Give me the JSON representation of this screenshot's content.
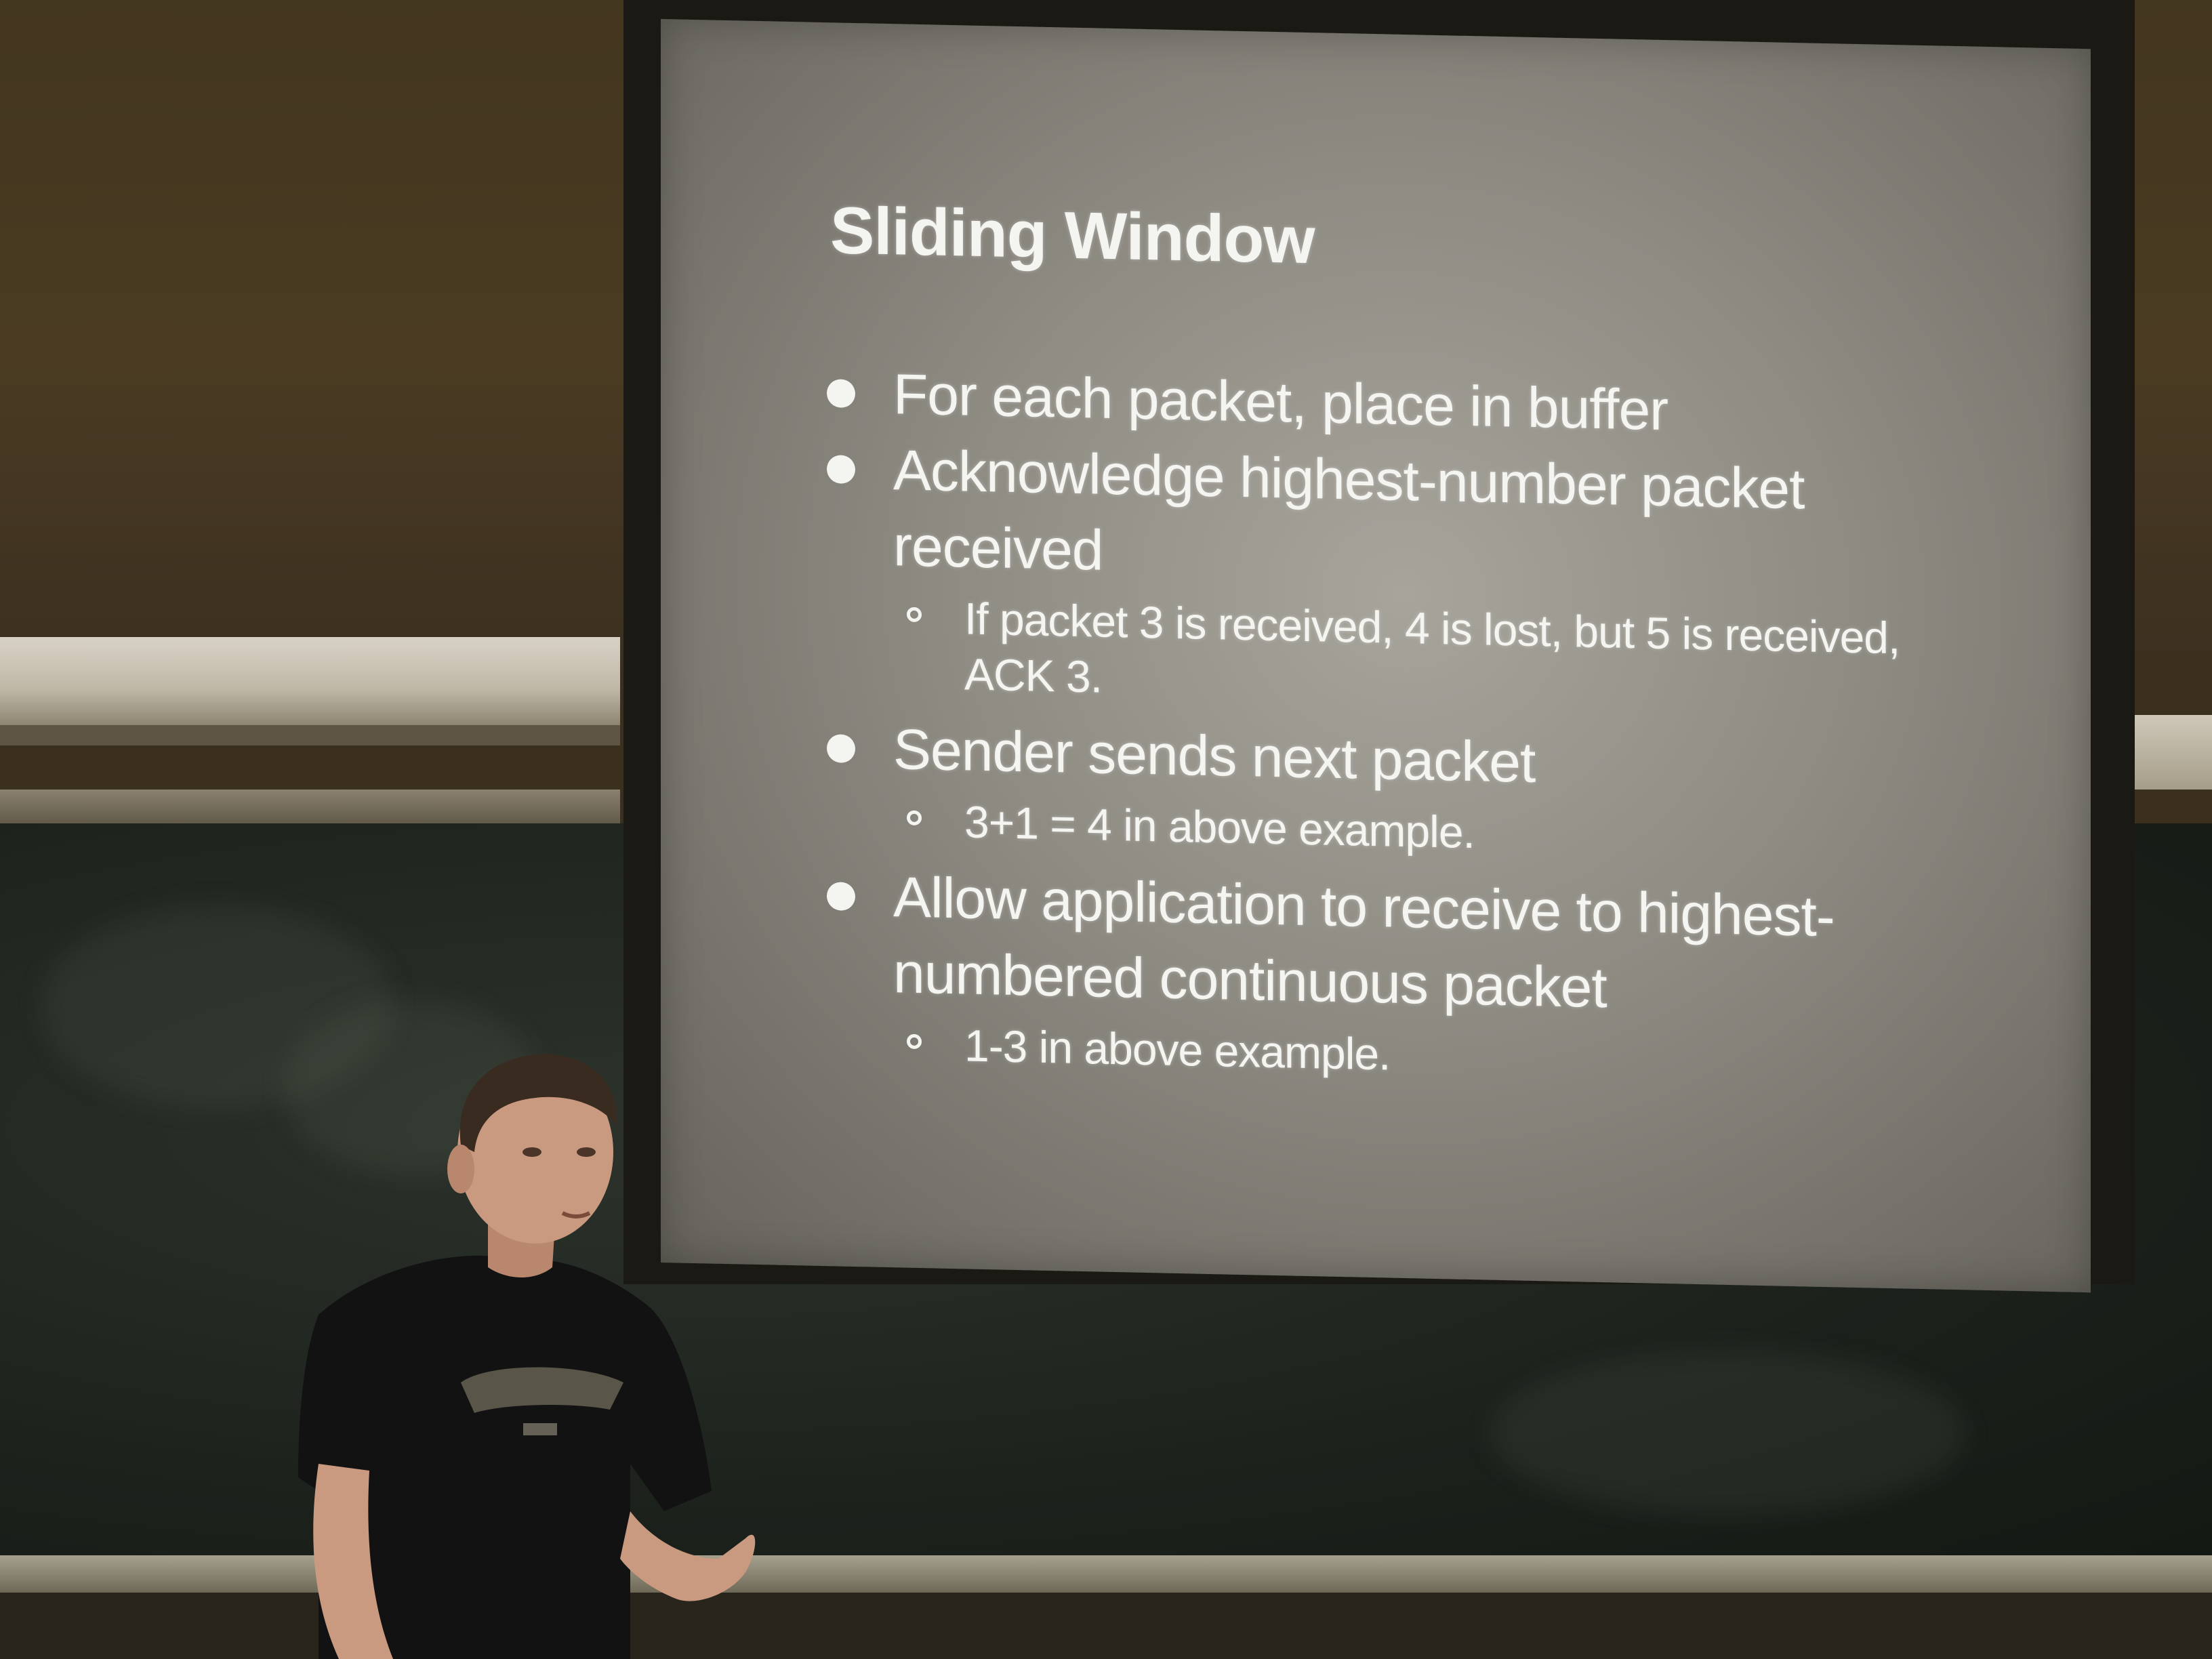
{
  "slide": {
    "title": "Sliding Window",
    "items": [
      {
        "text": "For each packet, place in buffer",
        "subitems": []
      },
      {
        "text": "Acknowledge highest-number packet received",
        "subitems": [
          "If packet 3 is received, 4 is lost, but 5 is received, ACK 3."
        ]
      },
      {
        "text": "Sender sends next packet",
        "subitems": [
          "3+1 = 4 in above example."
        ]
      },
      {
        "text": "Allow application to receive to highest-numbered continuous packet",
        "subitems": [
          "1-3 in above example."
        ]
      }
    ]
  },
  "colors": {
    "screen": "#8d8a82",
    "slide_text": "#f4f4f0",
    "chalkboard": "#1c211c",
    "wall": "#4a3b22",
    "shirt": "#121212",
    "skin": "#c99a80"
  },
  "icons": {
    "bullet": "filled-circle-icon",
    "subbullet": "hollow-circle-icon"
  }
}
